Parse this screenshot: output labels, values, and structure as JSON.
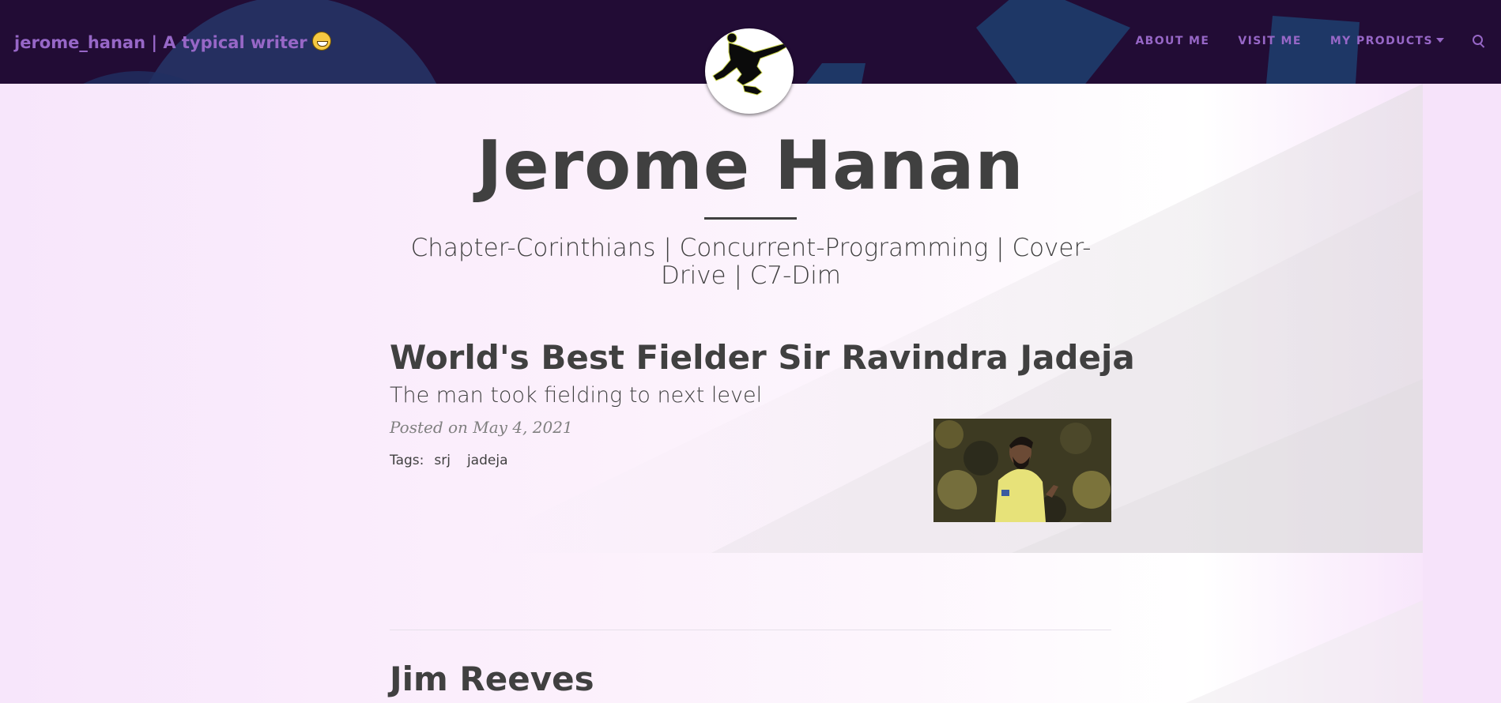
{
  "navbar": {
    "brand": "jerome_hanan | A typical writer",
    "brand_emoji": "grinning-face-icon",
    "links": [
      "ABOUT ME",
      "VISIT ME",
      "MY PRODUCTS"
    ],
    "search_icon": "search-icon",
    "color_bg": "#220c35",
    "color_text": "#9767c7"
  },
  "header": {
    "title": "Jerome Hanan",
    "subtitle": "Chapter-Corinthians | Concurrent-Programming | Cover-Drive | C7-Dim"
  },
  "posts": [
    {
      "title": "World's Best Fielder Sir Ravindra Jadeja",
      "subtitle": "The man took fielding to next level",
      "meta": "Posted on May 4, 2021",
      "tags_label": "Tags:",
      "tags": [
        "srj",
        "jadeja"
      ]
    },
    {
      "title": "Jim Reeves"
    }
  ]
}
